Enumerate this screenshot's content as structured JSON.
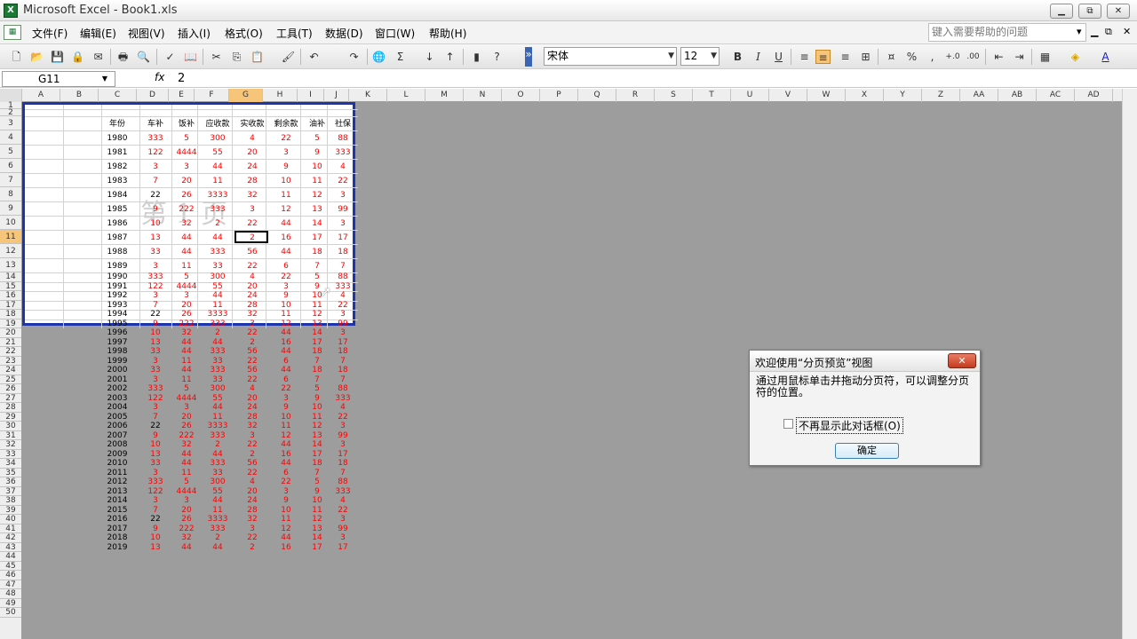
{
  "window": {
    "title": "Microsoft Excel - Book1.xls",
    "minimize": "▁",
    "restore": "⧉",
    "close": "✕"
  },
  "menu": {
    "items": [
      "文件(F)",
      "编辑(E)",
      "视图(V)",
      "插入(I)",
      "格式(O)",
      "工具(T)",
      "数据(D)",
      "窗口(W)",
      "帮助(H)"
    ],
    "help_placeholder": "键入需要帮助的问题",
    "mdi_controls": [
      "▾",
      "✕",
      "⧉",
      "✕"
    ]
  },
  "toolbar": {
    "font_name": "宋体",
    "font_size": "12",
    "icons": [
      "new-icon",
      "open-icon",
      "save-icon",
      "permission-icon",
      "print-icon",
      "print-preview-icon",
      "spelling-icon",
      "research-icon",
      "cut-icon",
      "copy-icon",
      "paste-icon",
      "format-painter-icon",
      "undo-icon",
      "redo-icon",
      "hyperlink-icon",
      "autosum-icon",
      "sort-ascending-icon",
      "sort-descending-icon",
      "chart-wizard-icon",
      "help-icon"
    ],
    "format_icons": [
      "bold-icon",
      "italic-icon",
      "underline-icon",
      "align-left-icon",
      "align-center-icon",
      "align-right-icon",
      "merge-center-icon",
      "currency-icon",
      "percent-icon",
      "comma-icon",
      "increase-decimal-icon",
      "decrease-decimal-icon",
      "decrease-indent-icon",
      "increase-indent-icon",
      "borders-icon",
      "fill-color-icon",
      "font-color-icon"
    ]
  },
  "formula_bar": {
    "name_box": "G11",
    "fx": "fx",
    "value": "2"
  },
  "columns": [
    "A",
    "B",
    "C",
    "D",
    "E",
    "F",
    "G",
    "H",
    "I",
    "J",
    "K",
    "L",
    "M",
    "N",
    "O",
    "P",
    "Q",
    "R",
    "S",
    "T",
    "U",
    "V",
    "W",
    "X",
    "Y",
    "Z",
    "AA",
    "AB",
    "AC",
    "AD"
  ],
  "rows": [
    "1",
    "2",
    "3",
    "4",
    "5",
    "6",
    "7",
    "8",
    "9",
    "10",
    "11",
    "12",
    "13",
    "14",
    "15",
    "16",
    "17",
    "18",
    "19",
    "20",
    "21",
    "22",
    "23",
    "24",
    "25",
    "26",
    "27",
    "28",
    "29",
    "30",
    "31",
    "32",
    "33",
    "34",
    "35",
    "36",
    "37",
    "38",
    "39",
    "40",
    "41",
    "42",
    "43",
    "44",
    "45",
    "46",
    "47",
    "48",
    "49",
    "50"
  ],
  "sheet": {
    "watermark": "第 1 页",
    "headers": [
      "年份",
      "车补",
      "饭补",
      "应收款",
      "实收款",
      "剩余款",
      "油补",
      "社保"
    ],
    "data": [
      [
        "1980",
        "333",
        "5",
        "300",
        "4",
        "22",
        "5",
        "88"
      ],
      [
        "1981",
        "122",
        "4444",
        "55",
        "20",
        "3",
        "9",
        "333"
      ],
      [
        "1982",
        "3",
        "3",
        "44",
        "24",
        "9",
        "10",
        "4"
      ],
      [
        "1983",
        "7",
        "20",
        "11",
        "28",
        "10",
        "11",
        "22"
      ],
      [
        "1984",
        "22",
        "26",
        "3333",
        "32",
        "11",
        "12",
        "3"
      ],
      [
        "1985",
        "9",
        "222",
        "333",
        "3",
        "12",
        "13",
        "99"
      ],
      [
        "1986",
        "10",
        "32",
        "2",
        "22",
        "44",
        "14",
        "3"
      ],
      [
        "1987",
        "13",
        "44",
        "44",
        "2",
        "16",
        "17",
        "17"
      ],
      [
        "1988",
        "33",
        "44",
        "333",
        "56",
        "44",
        "18",
        "18"
      ],
      [
        "1989",
        "3",
        "11",
        "33",
        "22",
        "6",
        "7",
        "7"
      ],
      [
        "1990",
        "333",
        "5",
        "300",
        "4",
        "22",
        "5",
        "88"
      ],
      [
        "1991",
        "122",
        "4444",
        "55",
        "20",
        "3",
        "9",
        "333"
      ],
      [
        "1992",
        "3",
        "3",
        "44",
        "24",
        "9",
        "10",
        "4"
      ],
      [
        "1993",
        "7",
        "20",
        "11",
        "28",
        "10",
        "11",
        "22"
      ],
      [
        "1994",
        "22",
        "26",
        "3333",
        "32",
        "11",
        "12",
        "3"
      ],
      [
        "1995",
        "9",
        "222",
        "333",
        "3",
        "12",
        "13",
        "99"
      ],
      [
        "1996",
        "10",
        "32",
        "2",
        "22",
        "44",
        "14",
        "3"
      ],
      [
        "1997",
        "13",
        "44",
        "44",
        "2",
        "16",
        "17",
        "17"
      ],
      [
        "1998",
        "33",
        "44",
        "333",
        "56",
        "44",
        "18",
        "18"
      ],
      [
        "1999",
        "3",
        "11",
        "33",
        "22",
        "6",
        "7",
        "7"
      ],
      [
        "2000",
        "33",
        "44",
        "333",
        "56",
        "44",
        "18",
        "18"
      ],
      [
        "2001",
        "3",
        "11",
        "33",
        "22",
        "6",
        "7",
        "7"
      ],
      [
        "2002",
        "333",
        "5",
        "300",
        "4",
        "22",
        "5",
        "88"
      ],
      [
        "2003",
        "122",
        "4444",
        "55",
        "20",
        "3",
        "9",
        "333"
      ],
      [
        "2004",
        "3",
        "3",
        "44",
        "24",
        "9",
        "10",
        "4"
      ],
      [
        "2005",
        "7",
        "20",
        "11",
        "28",
        "10",
        "11",
        "22"
      ],
      [
        "2006",
        "22",
        "26",
        "3333",
        "32",
        "11",
        "12",
        "3"
      ],
      [
        "2007",
        "9",
        "222",
        "333",
        "3",
        "12",
        "13",
        "99"
      ],
      [
        "2008",
        "10",
        "32",
        "2",
        "22",
        "44",
        "14",
        "3"
      ],
      [
        "2009",
        "13",
        "44",
        "44",
        "2",
        "16",
        "17",
        "17"
      ],
      [
        "2010",
        "33",
        "44",
        "333",
        "56",
        "44",
        "18",
        "18"
      ],
      [
        "2011",
        "3",
        "11",
        "33",
        "22",
        "6",
        "7",
        "7"
      ],
      [
        "2012",
        "333",
        "5",
        "300",
        "4",
        "22",
        "5",
        "88"
      ],
      [
        "2013",
        "122",
        "4444",
        "55",
        "20",
        "3",
        "9",
        "333"
      ],
      [
        "2014",
        "3",
        "3",
        "44",
        "24",
        "9",
        "10",
        "4"
      ],
      [
        "2015",
        "7",
        "20",
        "11",
        "28",
        "10",
        "11",
        "22"
      ],
      [
        "2016",
        "22",
        "26",
        "3333",
        "32",
        "11",
        "12",
        "3"
      ],
      [
        "2017",
        "9",
        "222",
        "333",
        "3",
        "12",
        "13",
        "99"
      ],
      [
        "2018",
        "10",
        "32",
        "2",
        "22",
        "44",
        "14",
        "3"
      ],
      [
        "2019",
        "13",
        "44",
        "44",
        "2",
        "16",
        "17",
        "17"
      ]
    ]
  },
  "dialog": {
    "title": "欢迎使用“分页预览”视图",
    "close": "✕",
    "message": "通过用鼠标单击并拖动分页符，可以调整分页符的位置。",
    "checkbox_label": "不再显示此对话框(O)",
    "ok": "确定"
  },
  "colors": {
    "page_border": "#1d35a8",
    "data_red": "#ff0000",
    "background_gray": "#9d9d9d"
  }
}
